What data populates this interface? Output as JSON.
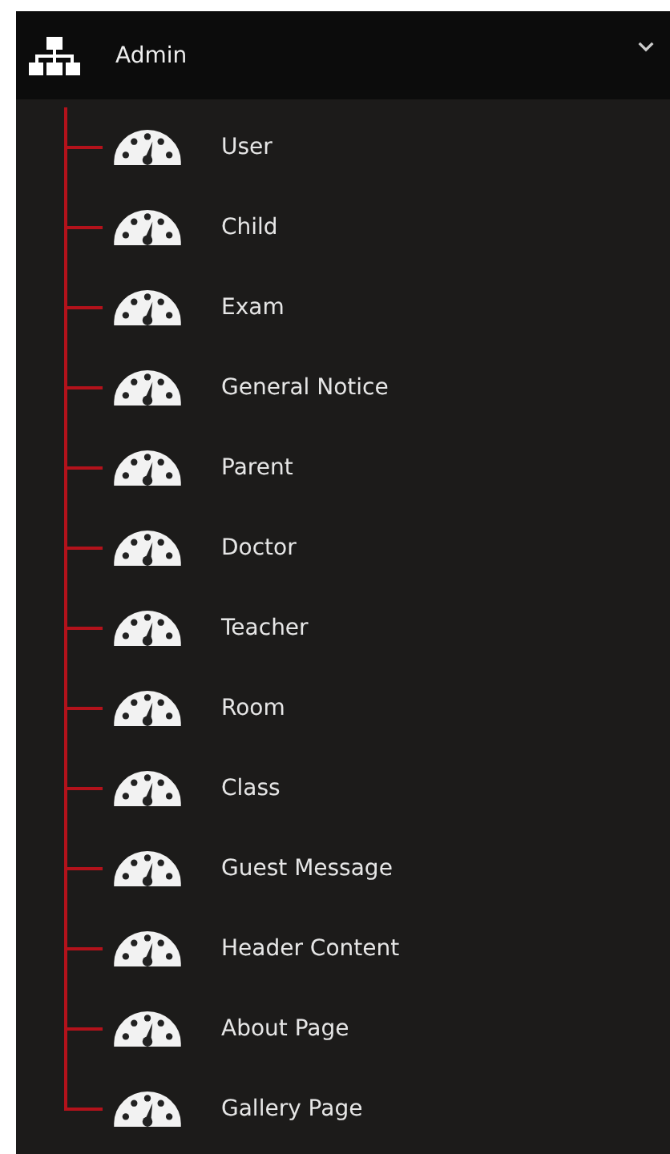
{
  "menu": {
    "title": "Admin",
    "expanded": true,
    "items": [
      {
        "label": "User"
      },
      {
        "label": "Child"
      },
      {
        "label": "Exam"
      },
      {
        "label": "General Notice"
      },
      {
        "label": "Parent"
      },
      {
        "label": "Doctor"
      },
      {
        "label": "Teacher"
      },
      {
        "label": "Room"
      },
      {
        "label": "Class"
      },
      {
        "label": "Guest Message"
      },
      {
        "label": "Header Content"
      },
      {
        "label": "About Page"
      },
      {
        "label": "Gallery Page"
      }
    ]
  }
}
